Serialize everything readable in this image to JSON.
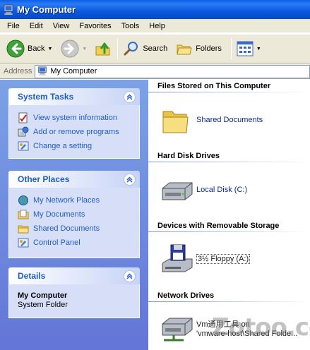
{
  "window": {
    "title": "My Computer"
  },
  "menu": [
    "File",
    "Edit",
    "View",
    "Favorites",
    "Tools",
    "Help"
  ],
  "toolbar": {
    "back_label": "Back",
    "search_label": "Search",
    "folders_label": "Folders"
  },
  "address": {
    "label": "Address",
    "value": "My Computer"
  },
  "task_pane": {
    "system_tasks": {
      "title": "System Tasks",
      "items": [
        "View system information",
        "Add or remove programs",
        "Change a setting"
      ]
    },
    "other_places": {
      "title": "Other Places",
      "items": [
        "My Network Places",
        "My Documents",
        "Shared Documents",
        "Control Panel"
      ]
    },
    "details": {
      "title": "Details",
      "name": "My Computer",
      "type": "System Folder"
    }
  },
  "groups": {
    "files_stored": {
      "title": "Files Stored on This Computer",
      "items": [
        "Shared Documents"
      ]
    },
    "hard_disks": {
      "title": "Hard Disk Drives",
      "items": [
        "Local Disk (C:)"
      ]
    },
    "removable": {
      "title": "Devices with Removable Storage",
      "items": [
        "3½ Floppy (A:)"
      ]
    },
    "network": {
      "title": "Network Drives",
      "line1": "Vm通用工具 on",
      "line2": "'vmware-host\\Shared Folde..."
    }
  },
  "watermark": "Zotoo.com",
  "colors": {
    "titlebar": "#0a5fe8",
    "taskpane": "#6375d6",
    "link": "#215dc6",
    "panel_title": "#215dc6"
  },
  "icons": {
    "app": "computer-icon",
    "back": "back-arrow-icon",
    "forward": "forward-arrow-icon",
    "up": "up-folder-icon",
    "search": "search-icon",
    "folders": "folders-icon",
    "views": "views-icon"
  }
}
